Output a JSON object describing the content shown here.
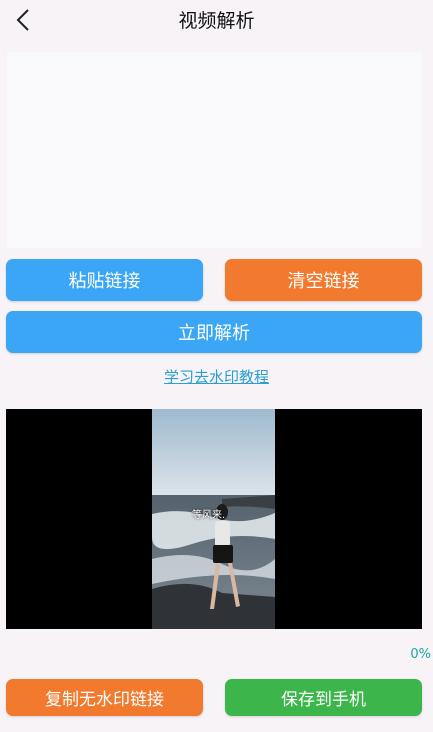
{
  "header": {
    "title": "视频解析",
    "back_icon": "chevron-left-icon"
  },
  "link_input": {
    "value": ""
  },
  "actions": {
    "paste_label": "粘贴链接",
    "clear_label": "清空链接",
    "parse_label": "立即解析",
    "tutorial_link": "学习去水印教程"
  },
  "player": {
    "caption": "等风来."
  },
  "progress": "0%",
  "footer": {
    "copy_label": "复制无水印链接",
    "save_label": "保存到手机"
  },
  "colors": {
    "blue": "#3ba6f5",
    "orange": "#f27a2e",
    "green": "#3cb54a",
    "link": "#2a9fd0"
  }
}
